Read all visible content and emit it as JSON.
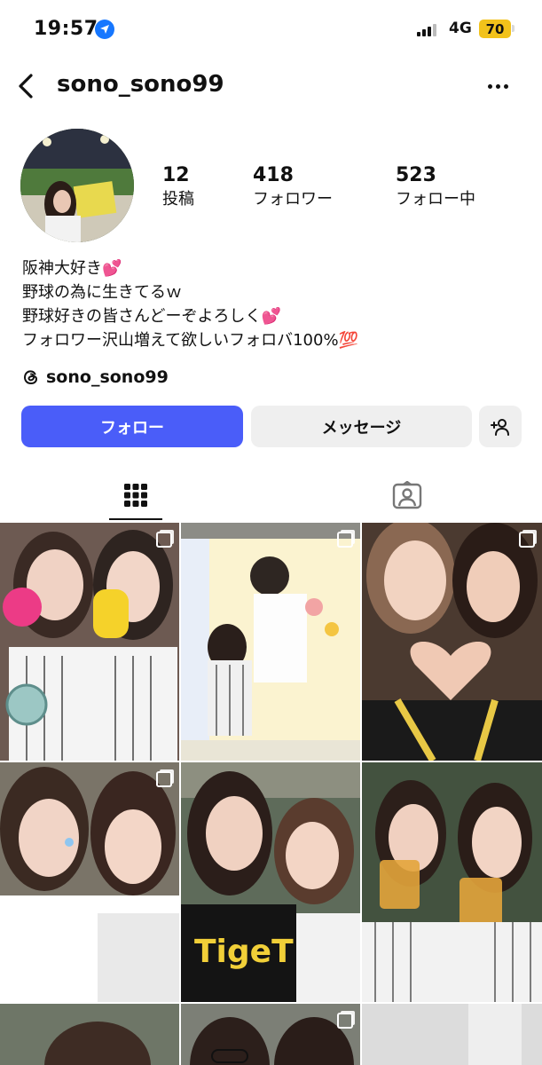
{
  "status_bar": {
    "time": "19:57",
    "network": "4G",
    "battery": "70",
    "location_icon": "location-arrow-icon",
    "signal_icon": "signal-bars-icon"
  },
  "header": {
    "username": "sono_sono99",
    "back_icon": "chevron-left-icon",
    "more_icon": "more-horizontal-icon"
  },
  "profile": {
    "stats": [
      {
        "value": "12",
        "label": "投稿"
      },
      {
        "value": "418",
        "label": "フォロワー"
      },
      {
        "value": "523",
        "label": "フォロー中"
      }
    ],
    "bio_lines": [
      "阪神大好き💕",
      "野球の為に生きてるｗ",
      "野球好きの皆さんどーぞよろしく💕",
      "フォロワー沢山増えて欲しいフォロバ100%💯"
    ],
    "threads_handle": "sono_sono99"
  },
  "actions": {
    "follow_label": "フォロー",
    "message_label": "メッセージ",
    "add_user_icon": "add-person-icon",
    "colors": {
      "follow": "#4a5df9",
      "secondary": "#efefef"
    }
  },
  "tabs": [
    {
      "name": "grid",
      "icon": "grid-icon",
      "selected": true
    },
    {
      "name": "tagged",
      "icon": "tagged-person-icon",
      "selected": false
    }
  ],
  "posts": [
    {
      "description": "stadium selfie with fans",
      "multi": true
    },
    {
      "description": "photo with player poster",
      "multi": true
    },
    {
      "description": "heart hands selfie",
      "multi": true
    },
    {
      "description": "face sticker selfie",
      "multi": true
    },
    {
      "description": "stadium selfie in black shirts",
      "multi": false
    },
    {
      "description": "beer cheers selfie",
      "multi": false
    },
    {
      "description": "stadium photo",
      "multi": false
    },
    {
      "description": "selfie with glasses",
      "multi": true
    },
    {
      "description": "stadium lights",
      "multi": false
    }
  ]
}
